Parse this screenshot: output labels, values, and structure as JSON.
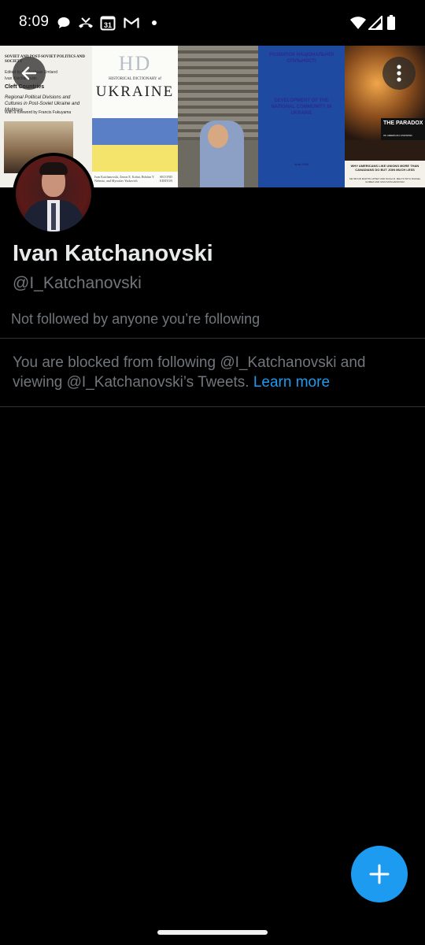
{
  "status_bar": {
    "time": "8:09",
    "calendar_day": "31",
    "icons": [
      "chat-bubble-icon",
      "missed-call-icon",
      "calendar-icon",
      "gmail-icon",
      "dot-icon",
      "wifi-icon",
      "signal-icon",
      "battery-icon"
    ]
  },
  "banner": {
    "book1": {
      "series": "SOVIET AND POST-SOVIET POLITICS AND SOCIETY",
      "editor": "Edited by Dr. Andreas Umland",
      "author": "Ivan Katchanovski",
      "title": "Cleft Countries",
      "subtitle": "Regional Political Divisions and Cultures in Post-Soviet Ukraine and Moldova",
      "foreword": "With a foreword by Francis Fukuyama"
    },
    "book2": {
      "logo": "HD",
      "series": "HISTORICAL DICTIONARY of",
      "title": "UKRAINE",
      "authors": "Ivan Katchanovski, Zenon E. Kohut, Bohdan Y. Nebesio, and Myroslav Yurkevich",
      "edition": "SECOND EDITION"
    },
    "book4": {
      "text_top": "РОЗВИТОК НАЦІОНАЛЬНОЇ СПІЛЬНОСТІ",
      "text_mid": "DEVELOPMENT OF THE NATIONAL COMMUNITY IN UKRAINE",
      "text_bottom": "Київ 2006"
    },
    "book5": {
      "title": "THE PARADOX",
      "subtitle": "OF AMERICAN UNIONISM",
      "tagline": "WHY AMERICANS LIKE UNIONS MORE THAN CANADIANS DO BUT JOIN MUCH LESS",
      "authors": "SEYMOUR MARTIN LIPSET AND NOAH M. MELTZ WITH RAFAEL GOMEZ AND IVAN KATCHANOVSKI"
    }
  },
  "profile": {
    "name": "Ivan Katchanovski",
    "handle": "@I_Katchanovski",
    "followers_note": "Not followed by anyone you’re following",
    "blocked_text": "You are blocked from following @I_Katchanovski and viewing @I_Katchanovski’s Tweets. ",
    "learn_more": "Learn more"
  },
  "colors": {
    "background": "#000000",
    "accent": "#1d9bf0",
    "secondary_text": "#71767b",
    "primary_text": "#e7e9ea",
    "divider": "#2f3336"
  }
}
